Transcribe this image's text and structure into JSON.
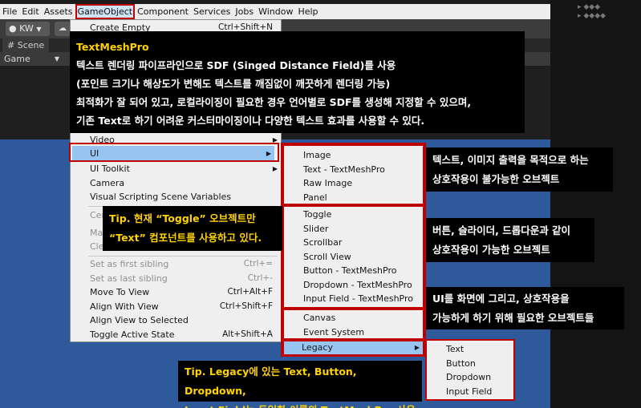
{
  "menubar": {
    "items": [
      "File",
      "Edit",
      "Assets",
      "GameObject",
      "Component",
      "Services",
      "Jobs",
      "Window",
      "Help"
    ]
  },
  "toolbar": {
    "account_label": "KW",
    "cloud_icon": "cloud-icon"
  },
  "scene_tab": {
    "label": "Scene"
  },
  "game_view": {
    "dropdown_value": "Game"
  },
  "gameobject_menu": {
    "create_empty": {
      "label": "Create Empty",
      "shortcut": "Ctrl+Shift+N"
    },
    "video": "Video",
    "ui": "UI",
    "ui_toolkit": "UI Toolkit",
    "camera": "Camera",
    "visual_scripting": "Visual Scripting Scene Variables",
    "center_partial": "Cen",
    "move_partial": "Ma",
    "clear_partial": "Cle",
    "set_first_sibling": {
      "label": "Set as first sibling",
      "shortcut": "Ctrl+="
    },
    "set_last_sibling": {
      "label": "Set as last sibling",
      "shortcut": "Ctrl+-"
    },
    "move_to_view": {
      "label": "Move To View",
      "shortcut": "Ctrl+Alt+F"
    },
    "align_with_view": {
      "label": "Align With View",
      "shortcut": "Ctrl+Shift+F"
    },
    "align_view_to_selected": {
      "label": "Align View to Selected"
    },
    "toggle_active_state": {
      "label": "Toggle Active State",
      "shortcut": "Alt+Shift+A"
    }
  },
  "ui_submenu": {
    "group1": [
      "Image",
      "Text - TextMeshPro",
      "Raw Image",
      "Panel"
    ],
    "group2": [
      "Toggle",
      "Slider",
      "Scrollbar",
      "Scroll View",
      "Button - TextMeshPro",
      "Dropdown - TextMeshPro",
      "Input Field - TextMeshPro"
    ],
    "group3": [
      "Canvas",
      "Event System"
    ],
    "legacy": "Legacy"
  },
  "legacy_submenu": [
    "Text",
    "Button",
    "Dropdown",
    "Input Field"
  ],
  "annotations": {
    "textmeshpro": {
      "title": "TextMeshPro",
      "line1": "텍스트 렌더링 파이프라인으로 SDF (Singed Distance Field)를 사용",
      "line2": "(포인트 크기나 해상도가 변해도 텍스트를 깨짐없이 깨끗하게 렌더링 가능)",
      "line3": "최적화가 잘 되어 있고, 로컬라이징이 필요한 경우 언어별로 SDF를 생성해 지정할 수 있으며,",
      "line4": "기존 Text로 하기 어려운 커스터마이징이나 다양한 텍스트 효과를 사용할 수 있다."
    },
    "toggle_tip": {
      "line1_hl": "Tip.",
      "line1": " 현재 “Toggle” 오브젝트만",
      "line2": "“Text” 컴포넌트를 사용하고 있다."
    },
    "legacy_tip": {
      "line1_hl": "Tip.",
      "line1": " Legacy에 있는 Text, Button, Dropdown,",
      "line2": "Input Field는 동일한 이름의 TextMeshPro 사용"
    },
    "group1_note": {
      "line1": "텍스트, 이미지 출력을 목적으로 하는",
      "line2": "상호작용이 불가능한 오브젝트"
    },
    "group2_note": {
      "line1": "버튼, 슬라이더, 드롭다운과 같이",
      "line2": "상호작용이 가능한 오브젝트"
    },
    "group3_note": {
      "line1": "UI를 화면에 그리고, 상호작용을",
      "line2": "가능하게 하기 위해 필요한 오브젝트들"
    }
  },
  "colors": {
    "highlight_border": "#c00000",
    "selection_blue": "#97c5f1",
    "tip_yellow": "#ffd200",
    "scene_blue": "#2e5a9c"
  }
}
